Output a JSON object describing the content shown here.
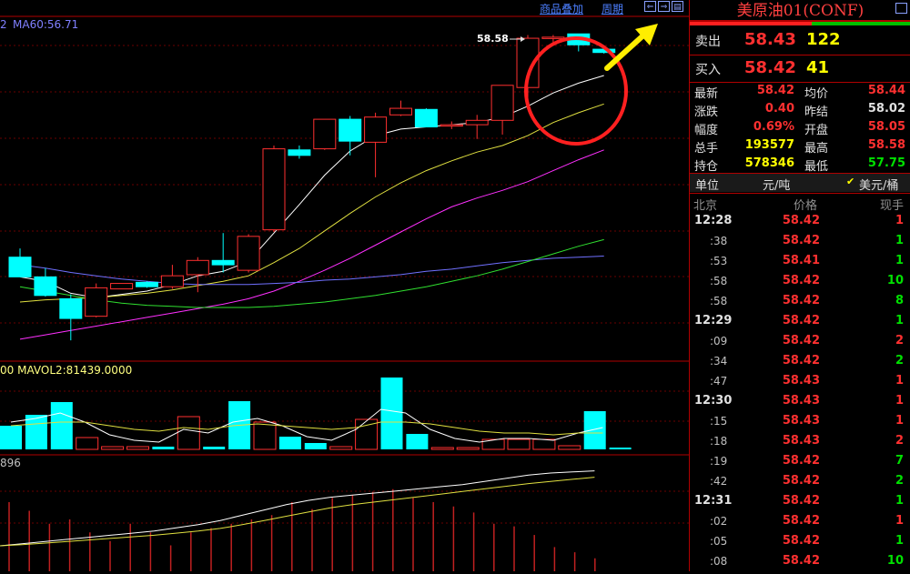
{
  "toolbar": {
    "overlay_label": "商品叠加",
    "period_label": "周期"
  },
  "chart_data": [
    {
      "type": "candlestick",
      "title": "",
      "labels": {
        "ma_readout": "MA60:56.71",
        "partial_prefix": "2",
        "peak_label": "58.58"
      },
      "series": [
        {
          "name": "candles",
          "values": [
            {
              "o": 56.55,
              "c": 56.37,
              "h": 56.63,
              "l": 56.37
            },
            {
              "o": 56.37,
              "c": 56.2,
              "h": 56.45,
              "l": 56.19
            },
            {
              "o": 56.17,
              "c": 55.99,
              "h": 56.21,
              "l": 55.79
            },
            {
              "o": 56.01,
              "c": 56.27,
              "h": 56.31,
              "l": 56.0
            },
            {
              "o": 56.26,
              "c": 56.31,
              "h": 56.31,
              "l": 56.26
            },
            {
              "o": 56.32,
              "c": 56.28,
              "h": 56.33,
              "l": 56.27
            },
            {
              "o": 56.28,
              "c": 56.38,
              "h": 56.48,
              "l": 56.26
            },
            {
              "o": 56.39,
              "c": 56.52,
              "h": 56.55,
              "l": 56.23
            },
            {
              "o": 56.52,
              "c": 56.48,
              "h": 56.77,
              "l": 56.41
            },
            {
              "o": 56.43,
              "c": 56.74,
              "h": 56.76,
              "l": 56.41
            },
            {
              "o": 56.8,
              "c": 57.54,
              "h": 57.57,
              "l": 56.78
            },
            {
              "o": 57.53,
              "c": 57.48,
              "h": 57.57,
              "l": 57.45
            },
            {
              "o": 57.54,
              "c": 57.81,
              "h": 57.81,
              "l": 57.53
            },
            {
              "o": 57.81,
              "c": 57.61,
              "h": 57.84,
              "l": 57.48
            },
            {
              "o": 57.6,
              "c": 57.83,
              "h": 57.87,
              "l": 57.28
            },
            {
              "o": 57.85,
              "c": 57.91,
              "h": 57.98,
              "l": 57.84
            },
            {
              "o": 57.9,
              "c": 57.74,
              "h": 57.91,
              "l": 57.74
            },
            {
              "o": 57.76,
              "c": 57.76,
              "h": 57.79,
              "l": 57.72
            },
            {
              "o": 57.76,
              "c": 57.8,
              "h": 57.85,
              "l": 57.63
            },
            {
              "o": 57.8,
              "c": 58.12,
              "h": 58.12,
              "l": 57.67
            },
            {
              "o": 58.1,
              "c": 58.55,
              "h": 58.58,
              "l": 58.0
            },
            {
              "o": 58.55,
              "c": 58.56,
              "h": 58.58,
              "l": 58.5
            },
            {
              "o": 58.59,
              "c": 58.49,
              "h": 58.59,
              "l": 58.43
            },
            {
              "o": 58.45,
              "c": 58.42,
              "h": 58.46,
              "l": 58.41
            }
          ]
        },
        {
          "name": "ma_white",
          "values": [
            56.37,
            56.33,
            56.22,
            56.18,
            56.21,
            56.24,
            56.3,
            56.38,
            56.42,
            56.51,
            56.77,
            57.03,
            57.3,
            57.52,
            57.66,
            57.72,
            57.74,
            57.76,
            57.78,
            57.83,
            57.93,
            58.05,
            58.14,
            58.21
          ]
        },
        {
          "name": "ma_yellow",
          "values": [
            56.14,
            56.16,
            56.17,
            56.18,
            56.2,
            56.22,
            56.25,
            56.29,
            56.33,
            56.38,
            56.5,
            56.63,
            56.79,
            56.95,
            57.1,
            57.23,
            57.34,
            57.43,
            57.51,
            57.57,
            57.66,
            57.78,
            57.87,
            57.95
          ]
        },
        {
          "name": "ma_magenta",
          "values": [
            55.8,
            55.84,
            55.88,
            55.92,
            55.96,
            56.0,
            56.04,
            56.08,
            56.12,
            56.17,
            56.24,
            56.33,
            56.43,
            56.54,
            56.66,
            56.78,
            56.9,
            57.01,
            57.09,
            57.16,
            57.24,
            57.34,
            57.44,
            57.53
          ]
        },
        {
          "name": "ma_blue",
          "values": [
            56.48,
            56.45,
            56.41,
            56.38,
            56.35,
            56.33,
            56.31,
            56.3,
            56.3,
            56.3,
            56.31,
            56.32,
            56.34,
            56.35,
            56.37,
            56.39,
            56.42,
            56.44,
            56.47,
            56.5,
            56.52,
            56.54,
            56.55,
            56.56
          ]
        },
        {
          "name": "ma_green",
          "values": [
            56.28,
            56.24,
            56.2,
            56.16,
            56.13,
            56.11,
            56.1,
            56.09,
            56.09,
            56.09,
            56.1,
            56.12,
            56.14,
            56.17,
            56.2,
            56.24,
            56.28,
            56.33,
            56.38,
            56.44,
            56.51,
            56.58,
            56.65,
            56.71
          ]
        }
      ]
    },
    {
      "type": "bar",
      "title": "",
      "labels": {
        "vol_readout": "00  MAVOL2:81439.0000"
      },
      "series": [
        {
          "name": "volume",
          "values": [
            26,
            38,
            52,
            13,
            3,
            3,
            3,
            36,
            3,
            53,
            30,
            14,
            7,
            3,
            33,
            79,
            17,
            2,
            2,
            11,
            11,
            11,
            4,
            42,
            2
          ]
        },
        {
          "name": "mavol_white",
          "values": [
            30,
            34,
            40,
            30,
            16,
            10,
            8,
            22,
            18,
            30,
            34,
            26,
            14,
            10,
            22,
            44,
            40,
            22,
            12,
            8,
            12,
            12,
            10,
            18,
            24
          ]
        },
        {
          "name": "mavol_yellow",
          "values": [
            26,
            28,
            30,
            30,
            26,
            22,
            20,
            24,
            22,
            26,
            28,
            26,
            24,
            22,
            24,
            30,
            30,
            28,
            24,
            20,
            18,
            18,
            16,
            18,
            18
          ]
        }
      ]
    },
    {
      "type": "bar",
      "title": "",
      "labels": {
        "oi_readout": "896"
      },
      "series": [
        {
          "name": "oi_bars",
          "values": [
            80,
            70,
            55,
            60,
            45,
            35,
            55,
            45,
            30,
            45,
            50,
            55,
            60,
            65,
            80,
            72,
            85,
            88,
            92,
            95,
            85,
            80,
            75,
            68,
            55,
            52,
            42,
            28,
            22,
            15
          ]
        },
        {
          "name": "oi_white",
          "values": [
            0,
            4,
            8,
            12,
            16,
            20,
            24,
            28,
            34,
            40,
            48,
            58,
            68,
            78,
            86,
            92,
            96,
            100,
            104,
            108,
            112,
            116,
            122,
            128,
            134,
            138,
            140,
            142
          ]
        },
        {
          "name": "oi_yellow",
          "values": [
            0,
            2,
            5,
            8,
            11,
            14,
            17,
            20,
            24,
            28,
            33,
            40,
            48,
            56,
            64,
            72,
            78,
            83,
            88,
            93,
            98,
            103,
            108,
            113,
            118,
            122,
            126,
            130
          ]
        }
      ]
    }
  ],
  "annotations": {
    "highlight_circle": "red circle around latest candles",
    "arrow": "yellow arrow pointing up-right"
  },
  "sidebar": {
    "symbol": "美原油01(CONF)",
    "sell": {
      "label": "卖出",
      "price": "58.43",
      "qty": "122"
    },
    "buy": {
      "label": "买入",
      "price": "58.42",
      "qty": "41"
    },
    "stats": [
      {
        "l1": "最新",
        "v1": "58.42",
        "l2": "均价",
        "v2": "58.44"
      },
      {
        "l1": "涨跌",
        "v1": "0.40",
        "l2": "昨结",
        "v2": "58.02"
      },
      {
        "l1": "幅度",
        "v1": "0.69%",
        "l2": "开盘",
        "v2": "58.05"
      },
      {
        "l1": "总手",
        "v1": "193577",
        "l2": "最高",
        "v2": "58.58"
      },
      {
        "l1": "持仓",
        "v1": "578346",
        "l2": "最低",
        "v2": "57.75"
      }
    ],
    "unit": {
      "label": "单位",
      "opt1": "元/吨",
      "opt2": "美元/桶",
      "check": "✔"
    },
    "ticks_header": {
      "time": "北京",
      "price": "价格",
      "qty": "现手"
    },
    "ticks": [
      {
        "time": "12:28",
        "price": "58.42",
        "qty": "1",
        "major": true
      },
      {
        "time": ":38",
        "price": "58.42",
        "qty": "1",
        "major": false
      },
      {
        "time": ":53",
        "price": "58.41",
        "qty": "1",
        "major": false
      },
      {
        "time": ":58",
        "price": "58.42",
        "qty": "10",
        "major": false
      },
      {
        "time": ":58",
        "price": "58.42",
        "qty": "8",
        "major": false
      },
      {
        "time": "12:29",
        "price": "58.42",
        "qty": "1",
        "major": true
      },
      {
        "time": ":09",
        "price": "58.42",
        "qty": "2",
        "major": false
      },
      {
        "time": ":34",
        "price": "58.42",
        "qty": "2",
        "major": false
      },
      {
        "time": ":47",
        "price": "58.43",
        "qty": "1",
        "major": false
      },
      {
        "time": "12:30",
        "price": "58.43",
        "qty": "1",
        "major": true
      },
      {
        "time": ":15",
        "price": "58.43",
        "qty": "1",
        "major": false
      },
      {
        "time": ":18",
        "price": "58.43",
        "qty": "2",
        "major": false
      },
      {
        "time": ":19",
        "price": "58.42",
        "qty": "7",
        "major": false
      },
      {
        "time": ":42",
        "price": "58.42",
        "qty": "2",
        "major": false
      },
      {
        "time": "12:31",
        "price": "58.42",
        "qty": "1",
        "major": true
      },
      {
        "time": ":02",
        "price": "58.42",
        "qty": "1",
        "major": false
      },
      {
        "time": ":05",
        "price": "58.42",
        "qty": "1",
        "major": false
      },
      {
        "time": ":08",
        "price": "58.42",
        "qty": "10",
        "major": false
      }
    ],
    "colors": {
      "up": "#ff3030",
      "down": "#00ffff",
      "buy_qty": "#ffff00",
      "green": "#00e000"
    }
  }
}
